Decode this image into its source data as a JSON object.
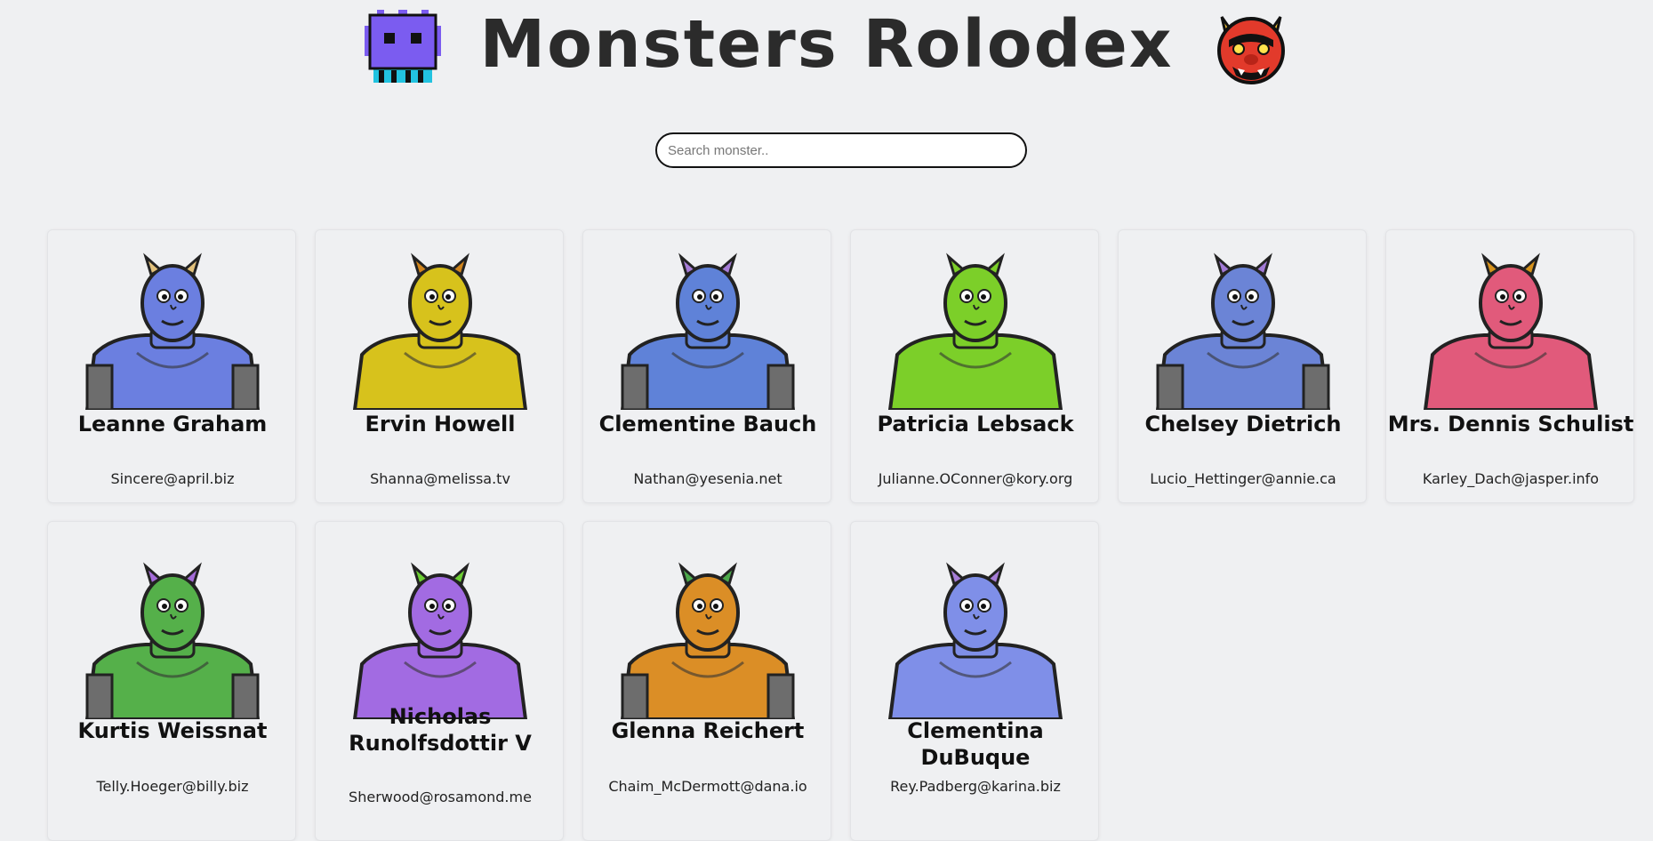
{
  "header": {
    "title": "Monsters Rolodex",
    "left_emoji": "purple-pixel-alien-icon",
    "right_emoji": "red-ogre-icon"
  },
  "search": {
    "placeholder": "Search monster..",
    "value": ""
  },
  "monsters": [
    {
      "name": "Leanne Graham",
      "email": "Sincere@april.biz",
      "color": "#6b7fe0",
      "horn": "#e3c27c"
    },
    {
      "name": "Ervin Howell",
      "email": "Shanna@melissa.tv",
      "color": "#d7c21c",
      "horn": "#d1851c"
    },
    {
      "name": "Clementine Bauch",
      "email": "Nathan@yesenia.net",
      "color": "#5f82d8",
      "horn": "#a77dd8"
    },
    {
      "name": "Patricia Lebsack",
      "email": "Julianne.OConner@kory.org",
      "color": "#7ccf29",
      "horn": "#7ccf29"
    },
    {
      "name": "Chelsey Dietrich",
      "email": "Lucio_Hettinger@annie.ca",
      "color": "#6b84d6",
      "horn": "#a27ad6"
    },
    {
      "name": "Mrs. Dennis Schulist",
      "email": "Karley_Dach@jasper.info",
      "color": "#e15a7b",
      "horn": "#d7931c"
    },
    {
      "name": "Kurtis Weissnat",
      "email": "Telly.Hoeger@billy.biz",
      "color": "#55b04a",
      "horn": "#a56cd9"
    },
    {
      "name": "Nicholas Runolfsdottir V",
      "email": "Sherwood@rosamond.me",
      "color": "#a26be2",
      "horn": "#6ccf33"
    },
    {
      "name": "Glenna Reichert",
      "email": "Chaim_McDermott@dana.io",
      "color": "#db8e26",
      "horn": "#4ca94b"
    },
    {
      "name": "Clementina DuBuque",
      "email": "Rey.Padberg@karina.biz",
      "color": "#7f8fe8",
      "horn": "#a77dd8"
    }
  ]
}
